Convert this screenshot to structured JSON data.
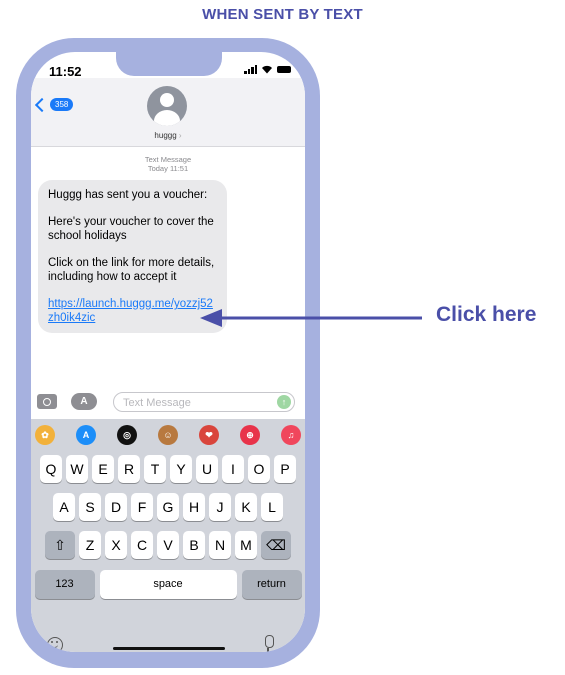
{
  "caption": "WHEN SENT BY TEXT",
  "status_bar": {
    "time": "11:52"
  },
  "header": {
    "back_count": "358",
    "contact_name": "huggg",
    "chevron": "›"
  },
  "conversation": {
    "meta_line1": "Text Message",
    "meta_line2": "Today 11:51",
    "message": {
      "line1": "Huggg has sent you a voucher:",
      "line2": "Here's your voucher to cover the school holidays",
      "line3": "Click on the link for more details, including how to accept it",
      "link": "https://launch.huggg.me/yozzj52zh0ik4zic"
    }
  },
  "composer": {
    "placeholder": "Text Message",
    "apps_glyph": "A",
    "send_glyph": "↑"
  },
  "app_strip": [
    {
      "name": "photos",
      "color": "#f2b13b",
      "glyph": "✿"
    },
    {
      "name": "app-store",
      "color": "#1c8ef9",
      "glyph": "A"
    },
    {
      "name": "fitness",
      "color": "#111111",
      "glyph": "◎"
    },
    {
      "name": "memoji",
      "color": "#b8793f",
      "glyph": "☺"
    },
    {
      "name": "stickers",
      "color": "#d9453c",
      "glyph": "❤"
    },
    {
      "name": "search-images",
      "color": "#e8334a",
      "glyph": "⊕"
    },
    {
      "name": "music",
      "color": "#f0465c",
      "glyph": "♫"
    }
  ],
  "keyboard": {
    "row1": [
      "Q",
      "W",
      "E",
      "R",
      "T",
      "Y",
      "U",
      "I",
      "O",
      "P"
    ],
    "row2": [
      "A",
      "S",
      "D",
      "F",
      "G",
      "H",
      "J",
      "K",
      "L"
    ],
    "row3": [
      "Z",
      "X",
      "C",
      "V",
      "B",
      "N",
      "M"
    ],
    "shift": "⇧",
    "delete": "⌫",
    "numbers": "123",
    "space": "space",
    "return": "return"
  },
  "annotation": {
    "label": "Click here"
  },
  "colors": {
    "accent": "#4a4fa8",
    "frame": "#a6b1df",
    "ios_blue": "#1a7af8"
  }
}
